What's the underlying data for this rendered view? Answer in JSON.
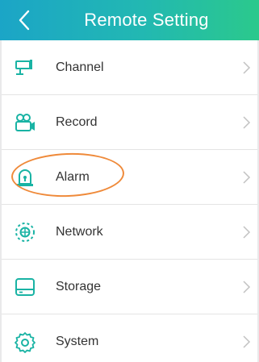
{
  "header": {
    "title": "Remote Setting",
    "back_icon": "chevron-left-icon",
    "colors": {
      "gradient_start": "#1ba5c7",
      "gradient_end": "#2bc98c"
    }
  },
  "menu": {
    "accent_color": "#19b3a4",
    "items": [
      {
        "label": "Channel",
        "icon": "camera-channel-icon"
      },
      {
        "label": "Record",
        "icon": "video-record-icon"
      },
      {
        "label": "Alarm",
        "icon": "alarm-light-icon"
      },
      {
        "label": "Network",
        "icon": "network-globe-icon"
      },
      {
        "label": "Storage",
        "icon": "storage-drive-icon"
      },
      {
        "label": "System",
        "icon": "gear-icon"
      }
    ]
  },
  "annotation": {
    "type": "highlight-circle",
    "target": "Alarm",
    "color": "#ef8a3a"
  }
}
